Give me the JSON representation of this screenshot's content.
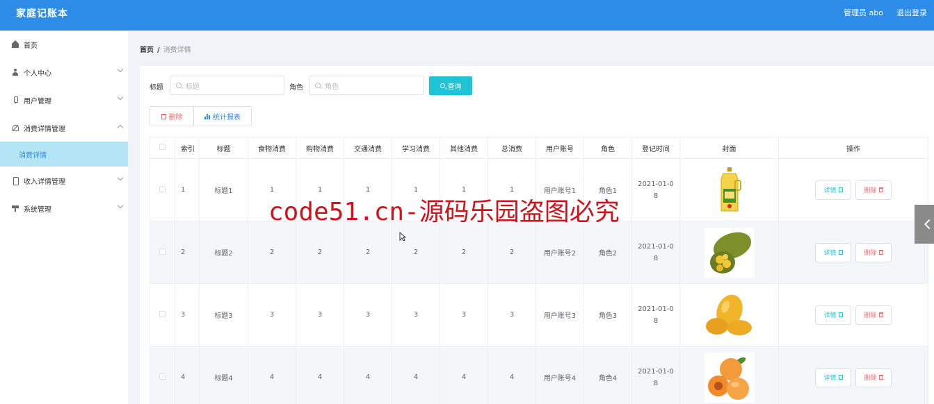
{
  "header": {
    "brand": "家庭记账本",
    "admin": "管理员 abo",
    "logout": "退出登录",
    "bg_color": "#2d8ce8"
  },
  "sidebar": {
    "items": [
      {
        "label": "首页",
        "icon": "home-icon",
        "has_arrow": false
      },
      {
        "label": "个人中心",
        "icon": "user-icon",
        "has_arrow": true
      },
      {
        "label": "用户管理",
        "icon": "mic-icon",
        "has_arrow": true
      },
      {
        "label": "消费详情管理",
        "icon": "bell-off-icon",
        "has_arrow": true,
        "expanded": true
      },
      {
        "label": "收入详情管理",
        "icon": "phone-icon",
        "has_arrow": true
      },
      {
        "label": "系统管理",
        "icon": "system-icon",
        "has_arrow": true
      }
    ],
    "sub_item": "消费详情",
    "active_color": "#b3e5f5"
  },
  "breadcrumb": {
    "home": "首页",
    "separator": "/",
    "current": "消费详情"
  },
  "search": {
    "title_label": "标题",
    "title_placeholder": "标题",
    "role_label": "角色",
    "role_placeholder": "角色",
    "query_button": "查询"
  },
  "actions": {
    "delete": "删除",
    "stats": "统计报表"
  },
  "table": {
    "headers": [
      "",
      "索引",
      "标题",
      "食物消费",
      "购物消费",
      "交通消费",
      "学习消费",
      "其他消费",
      "总消费",
      "用户账号",
      "角色",
      "登记时间",
      "封面",
      "操作"
    ],
    "rows": [
      {
        "index": "1",
        "title": "标题1",
        "food": "1",
        "shopping": "1",
        "traffic": "1",
        "study": "1",
        "other": "1",
        "total": "1",
        "account": "用户账号1",
        "role": "角色1",
        "time_a": "2021-01-0",
        "time_b": "8",
        "cover": "oil-bottle"
      },
      {
        "index": "2",
        "title": "标题2",
        "food": "2",
        "shopping": "2",
        "traffic": "2",
        "study": "2",
        "other": "2",
        "total": "2",
        "account": "用户账号2",
        "role": "角色2",
        "time_a": "2021-01-0",
        "time_b": "8",
        "cover": "jackfruit"
      },
      {
        "index": "3",
        "title": "标题3",
        "food": "3",
        "shopping": "3",
        "traffic": "3",
        "study": "3",
        "other": "3",
        "total": "3",
        "account": "用户账号3",
        "role": "角色3",
        "time_a": "2021-01-0",
        "time_b": "8",
        "cover": "mango"
      },
      {
        "index": "4",
        "title": "标题4",
        "food": "4",
        "shopping": "4",
        "traffic": "4",
        "study": "4",
        "other": "4",
        "total": "4",
        "account": "用户账号4",
        "role": "角色4",
        "time_a": "2021-01-0",
        "time_b": "8",
        "cover": "apricot"
      }
    ],
    "detail_label": "详情",
    "delete_label": "删除"
  },
  "watermark": "code51.cn-源码乐园盗图必究"
}
